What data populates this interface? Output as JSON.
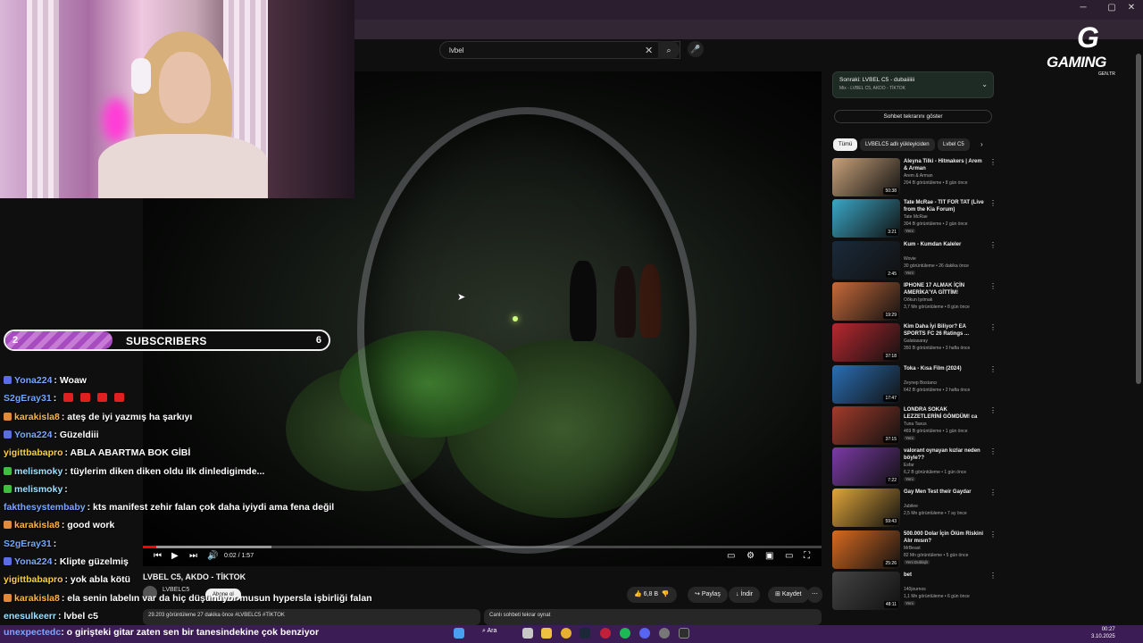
{
  "browser": {
    "window_controls": [
      "─",
      "▢",
      "✕"
    ]
  },
  "search": {
    "value": "lvbel",
    "clear": "✕",
    "search_icon": "⌕",
    "mic_icon": "🎤"
  },
  "player": {
    "time": "0:02 / 1:57",
    "progress_fraction": 0.02,
    "buffer_fraction": 0.19,
    "controls": {
      "prev": "⏮",
      "play": "▶",
      "next": "⏭",
      "volume": "🔊",
      "subtitles": "▭",
      "settings": "⚙",
      "miniplayer": "▣",
      "theater": "▭",
      "fullscreen": "⛶"
    }
  },
  "video": {
    "title": "LVBEL C5, AKDO - TİKTOK",
    "channel": "LVBELC5",
    "subscribe": "Abone ol",
    "likes": "6,8 B",
    "share": "Paylaş",
    "download": "İndir",
    "save": "Kaydet",
    "more": "⋯",
    "description": "29.203 görüntüleme  27 dakika önce  #LVBELC5 #TİKTOK",
    "chat_replay": "Canlı sohbeti tekrar oynat"
  },
  "sidebar": {
    "up_next_title": "Sonraki: LVBEL C5 - dubaiiiiii",
    "up_next_sub": "Mix - LVBEL C5, AKDO - TİKTOK",
    "show_chat": "Sohbet tekrarını göster",
    "chips": [
      "Tümü",
      "LVBELC5 adlı yükleyiciden",
      "Lvbel C5"
    ],
    "recommendations": [
      {
        "title": "Aleyna Tilki - Hitmakers | Arem & Arman",
        "channel": "Arem & Arman",
        "meta": "204 B görüntüleme • 8 gün önce",
        "duration": "50:38",
        "badge": "",
        "color": "#c9a27b"
      },
      {
        "title": "Tate McRae - TIT FOR TAT (Live from the Kia Forum)",
        "channel": "Tate McRae",
        "meta": "304 B görüntüleme • 2 gün önce",
        "duration": "3:21",
        "badge": "Yeni",
        "color": "#3aa7c7"
      },
      {
        "title": "Kum - Kumdan Kaleler",
        "channel": "Wovie",
        "meta": "30 görüntüleme • 26 dakika önce",
        "duration": "2:45",
        "badge": "Yeni",
        "color": "#1a2a3a"
      },
      {
        "title": "IPHONE 17 ALMAK İÇİN AMERİKA'YA GİTTİM!",
        "channel": "Oðkun Işıtmak",
        "meta": "3,7 Mn görüntüleme • 8 gün önce",
        "duration": "19:29",
        "badge": "",
        "color": "#c86a3a"
      },
      {
        "title": "Kim Daha İyi Biliyor? EA SPORTS FC 26 Ratings ...",
        "channel": "Galatasaray",
        "meta": "350 B görüntüleme • 3 hafta önce",
        "duration": "37:18",
        "badge": "",
        "color": "#b8282f"
      },
      {
        "title": "Toka - Kısa Film (2024)",
        "channel": "Zeynep Bostancı",
        "meta": "642 B görüntüleme • 2 hafta önce",
        "duration": "17:47",
        "badge": "",
        "color": "#2a6fb5"
      },
      {
        "title": "LONDRA SOKAK LEZZETLERİNİ GÖMDÜM! ca",
        "channel": "Tuna Tavus",
        "meta": "469 B görüntüleme • 1 gün önce",
        "duration": "37:15",
        "badge": "Yeni",
        "color": "#a33b2b"
      },
      {
        "title": "valorant oynayan kızlar neden böyle??",
        "channel": "Esfar",
        "meta": "6,2 B görüntüleme • 1 gün önce",
        "duration": "7:22",
        "badge": "Yeni",
        "color": "#7c3aa8"
      },
      {
        "title": "Gay Men Test their Gaydar",
        "channel": "Jubilee",
        "meta": "2,5 Mn görüntüleme • 7 ay önce",
        "duration": "59:43",
        "badge": "",
        "color": "#e0a53a"
      },
      {
        "title": "500.000 Dolar İçin Ölüm Riskini Alır mısın?",
        "channel": "MrBeast",
        "meta": "82 Mn görüntüleme • 5 gün önce",
        "duration": "25:26",
        "badge": "Yeni  Dublajlı",
        "color": "#d86a20"
      },
      {
        "title": "bet",
        "channel": "140journos",
        "meta": "1,1 Mn görüntüleme • 6 gün önce",
        "duration": "48:11",
        "badge": "Yeni",
        "color": "#444444"
      }
    ]
  },
  "overlay": {
    "subs_current": "2",
    "subs_label": "SUBSCRIBERS",
    "subs_goal": "6",
    "logo_text": "GAMING",
    "logo_sub": "GEN.TR",
    "chat": [
      {
        "user": "Yona224",
        "msg": ": Woaw",
        "color": "#7aa7ff",
        "badge": "#5b6ee1"
      },
      {
        "user": "S2gEray31",
        "msg": ":",
        "color": "#6fa8ff",
        "badge": "",
        "hearts": 4
      },
      {
        "user": "karakisla8",
        "msg": ": ateş de iyi yazmış ha şarkıyı",
        "color": "#ffb347",
        "badge": "#e08a3c"
      },
      {
        "user": "Yona224",
        "msg": ": Güzeldiii",
        "color": "#7aa7ff",
        "badge": "#5b6ee1"
      },
      {
        "user": "yigittbabapro",
        "msg": ": ABLA ABARTMA BOK GİBİ",
        "color": "#ffcf3a",
        "badge": ""
      },
      {
        "user": "melismoky",
        "msg": ": tüylerim diken diken oldu ilk dinledigimde...",
        "color": "#9fe0ff",
        "badge": "#3fbf3f"
      },
      {
        "user": "melismoky",
        "msg": ":",
        "color": "#9fe0ff",
        "badge": "#3fbf3f"
      },
      {
        "user": "fakthesystembaby",
        "msg": ": kts manifest zehir falan çok daha iyiydi ama fena değil",
        "color": "#7aa7ff",
        "badge": ""
      },
      {
        "user": "karakisla8",
        "msg": ": good work",
        "color": "#ffb347",
        "badge": "#e08a3c"
      },
      {
        "user": "S2gEray31",
        "msg": ":",
        "color": "#6fa8ff",
        "badge": ""
      },
      {
        "user": "Yona224",
        "msg": ": Klipte güzelmiş",
        "color": "#7aa7ff",
        "badge": "#5b6ee1"
      },
      {
        "user": "yigittbabapro",
        "msg": ": yok abla kötü",
        "color": "#ffcf3a",
        "badge": ""
      },
      {
        "user": "karakisla8",
        "msg": ": ela senin labelın var da hiç düşünüyor musun hypersla işbirliği falan",
        "color": "#ffb347",
        "badge": "#e08a3c"
      },
      {
        "user": "enesulkeerr",
        "msg": ": lvbel c5",
        "color": "#9fe0ff",
        "badge": ""
      }
    ],
    "ticker_user": "unexpectedc",
    "ticker_msg": ": o girişteki gitar zaten sen bir tanesindekine çok benziyor"
  },
  "taskbar": {
    "search": "Ara",
    "time": "00:27",
    "date": "3.10.2025"
  }
}
